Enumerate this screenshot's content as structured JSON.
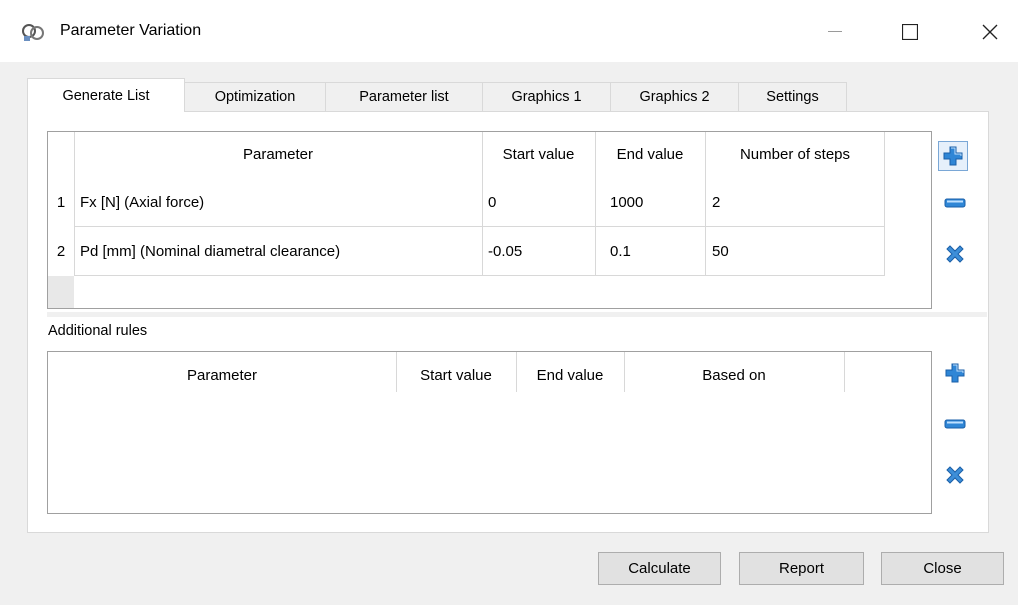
{
  "window": {
    "title": "Parameter Variation"
  },
  "tabs": [
    {
      "label": "Generate List",
      "active": true
    },
    {
      "label": "Optimization"
    },
    {
      "label": "Parameter list"
    },
    {
      "label": "Graphics 1"
    },
    {
      "label": "Graphics 2"
    },
    {
      "label": "Settings"
    }
  ],
  "generate_table": {
    "columns": [
      "Parameter",
      "Start value",
      "End value",
      "Number of steps"
    ],
    "rows": [
      {
        "num": "1",
        "parameter": "Fx [N]  (Axial force)",
        "start": "0",
        "end": "1000",
        "steps": "2"
      },
      {
        "num": "2",
        "parameter": "Pd [mm]  (Nominal diametral clearance)",
        "start": "-0.05",
        "end": "0.1",
        "steps": "50"
      }
    ]
  },
  "additional_rules": {
    "label": "Additional rules",
    "columns": [
      "Parameter",
      "Start value",
      "End value",
      "Based on"
    ]
  },
  "buttons": {
    "calculate": "Calculate",
    "report": "Report",
    "close": "Close"
  },
  "colors": {
    "accent": "#2f86d6",
    "delete": "#3d8ed8"
  },
  "icons": [
    "add-icon",
    "remove-icon",
    "delete-icon",
    "minimize-icon",
    "maximize-icon",
    "close-icon",
    "app-icon"
  ]
}
